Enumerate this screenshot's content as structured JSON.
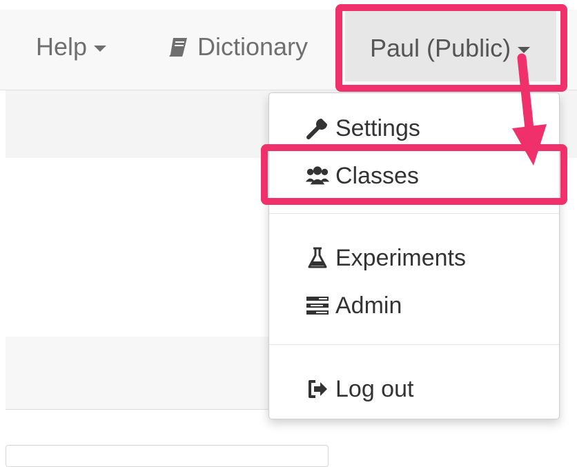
{
  "navbar": {
    "help_label": "Help",
    "dictionary_label": "Dictionary",
    "user_label": "Paul (Public)"
  },
  "dropdown": {
    "items": [
      {
        "label": "Settings",
        "icon": "wrench-icon"
      },
      {
        "label": "Classes",
        "icon": "users-icon"
      },
      {
        "label": "Experiments",
        "icon": "flask-icon"
      },
      {
        "label": "Admin",
        "icon": "tasks-icon"
      },
      {
        "label": "Log out",
        "icon": "sign-out-icon"
      }
    ]
  },
  "annotation": {
    "highlight_color": "#f0306a"
  }
}
